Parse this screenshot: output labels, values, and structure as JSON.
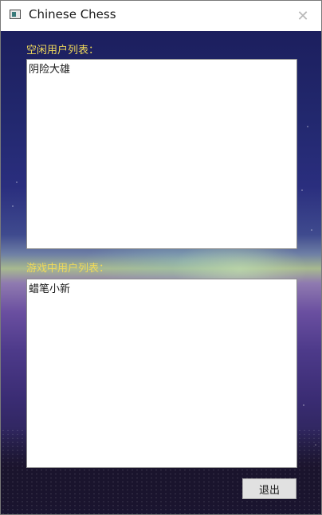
{
  "window": {
    "title": "Chinese Chess",
    "close_glyph": "✕",
    "icon": "app-window-icon"
  },
  "idle_users": {
    "label": "空闲用户列表：",
    "items": [
      "阴险大雄"
    ]
  },
  "playing_users": {
    "label": "游戏中用户列表：",
    "items": [
      "蜡笔小新"
    ]
  },
  "actions": {
    "exit_label": "退出"
  },
  "colors": {
    "label_text": "#f0d95a",
    "sky_top": "#1c1f5e",
    "ground": "#1a1430"
  }
}
